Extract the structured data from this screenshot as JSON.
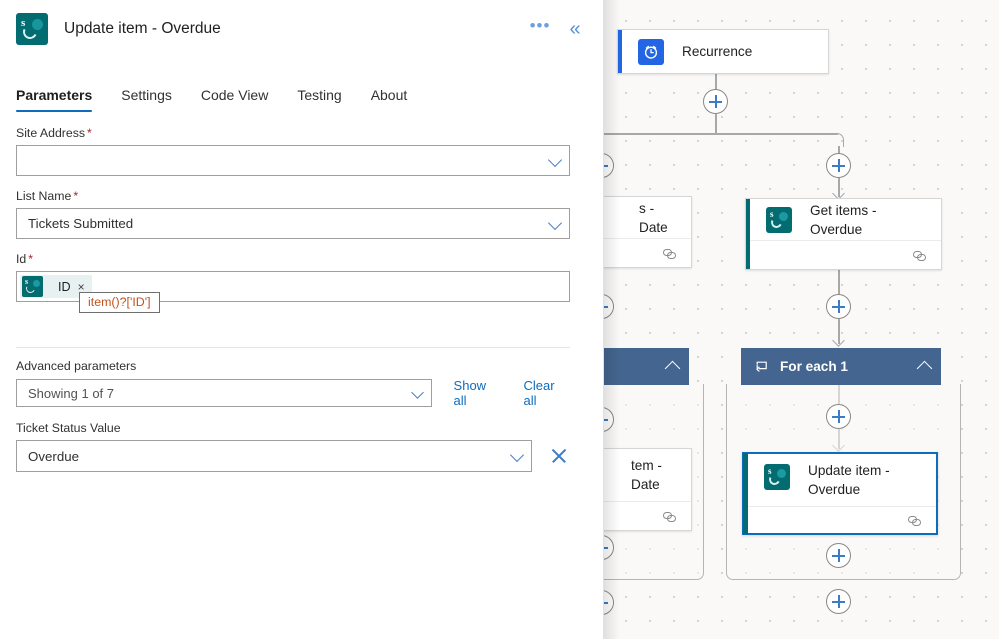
{
  "panel": {
    "icon": "sharepoint-icon",
    "title": "Update item - Overdue",
    "more_label": "•••",
    "collapse_label": "«",
    "tabs": [
      {
        "label": "Parameters",
        "active": true
      },
      {
        "label": "Settings",
        "active": false
      },
      {
        "label": "Code View",
        "active": false
      },
      {
        "label": "Testing",
        "active": false
      },
      {
        "label": "About",
        "active": false
      }
    ],
    "fields": {
      "site_address": {
        "label": "Site Address",
        "required_marker": "*",
        "value": "",
        "placeholder": ""
      },
      "list_name": {
        "label": "List Name",
        "required_marker": "*",
        "value": "Tickets Submitted"
      },
      "id": {
        "label": "Id",
        "required_marker": "*",
        "token_label": "ID",
        "token_remove": "×",
        "tooltip": "item()?['ID']"
      },
      "advanced": {
        "label": "Advanced parameters",
        "value": "Showing 1 of 7",
        "show_all": "Show all",
        "clear_all": "Clear all"
      },
      "ticket_status": {
        "label": "Ticket Status Value",
        "value": "Overdue",
        "clear_title": "Clear"
      }
    }
  },
  "canvas": {
    "nodes": [
      {
        "id": "recurrence",
        "title": "Recurrence",
        "icon": "clock-icon",
        "accent": "#2266e3",
        "has_footer": false
      },
      {
        "id": "get-items-overdue",
        "title": "Get items - Overdue",
        "icon": "sharepoint-icon",
        "accent": "#036c70",
        "has_footer": true
      },
      {
        "id": "update-item-overdue",
        "title": "Update item - Overdue",
        "icon": "sharepoint-icon",
        "accent": "#036c70",
        "has_footer": true,
        "selected": true
      }
    ],
    "partial_nodes": [
      {
        "id": "partial-date-1",
        "title": "s - Date"
      },
      {
        "id": "partial-date-2",
        "title": "tem - Date"
      }
    ],
    "scopes": [
      {
        "id": "for-each-1",
        "title": "For each 1",
        "icon": "loop-icon",
        "collapse": "^"
      },
      {
        "id": "for-each-partial",
        "title": "",
        "icon": "",
        "collapse": "^"
      }
    ],
    "add_button_label": "+",
    "colors": {
      "scope_header": "#44658f",
      "accent_blue": "#0f6cbd",
      "sharepoint_teal": "#036c70"
    }
  }
}
